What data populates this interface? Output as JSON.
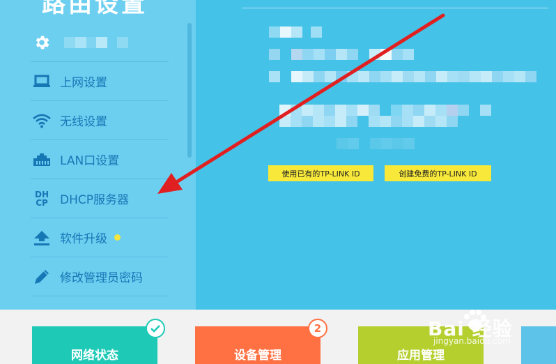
{
  "sidebar": {
    "title": "路由设置",
    "items": [
      {
        "label": "",
        "icon": "gear-icon"
      },
      {
        "label": "上网设置",
        "icon": "laptop-icon"
      },
      {
        "label": "无线设置",
        "icon": "wifi-icon"
      },
      {
        "label": "LAN口设置",
        "icon": "lan-port-icon"
      },
      {
        "label": "DHCP服务器",
        "icon": "dhcp-icon"
      },
      {
        "label": "软件升级",
        "icon": "upload-icon"
      },
      {
        "label": "修改管理员密码",
        "icon": "pencil-icon"
      }
    ],
    "dhcp_icon_text": {
      "top": "DH",
      "bottom": "CP"
    }
  },
  "main": {
    "buttons": {
      "use_existing": "使用已有的TP-LINK ID",
      "create_free": "创建免费的TP-LINK ID"
    }
  },
  "tiles": [
    {
      "label": "网络状态",
      "color": "#1ecab6"
    },
    {
      "label": "设备管理",
      "color": "#ff7043",
      "badge": "2"
    },
    {
      "label": "应用管理",
      "color": "#b4cf2e"
    }
  ],
  "watermark": {
    "text": "Bai 经验",
    "sub": "jingyan.baidu.com"
  },
  "colors": {
    "sidebar_bg": "#6ccff0",
    "main_bg": "#45c2e7",
    "menu_text": "#1677b5",
    "button_yellow": "#f7e83a",
    "arrow": "#e02020"
  }
}
